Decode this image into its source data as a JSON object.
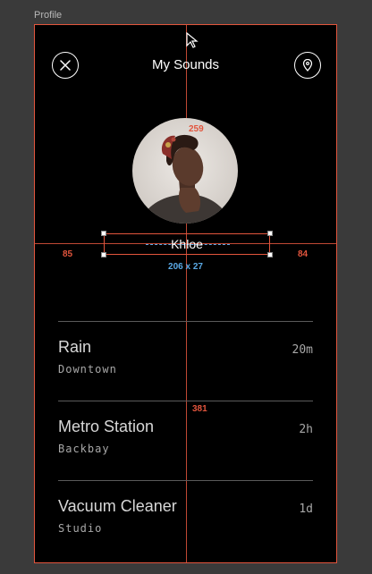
{
  "frame": {
    "label": "Profile"
  },
  "header": {
    "title": "My Sounds",
    "close_icon": "close-icon",
    "pin_icon": "map-pin-icon"
  },
  "profile": {
    "name": "Khloe",
    "avatar_alt": "profile photo"
  },
  "measurements": {
    "avatar_to_top": "259",
    "left_spacing": "85",
    "right_spacing": "84",
    "selection_size": "206 x 27",
    "list_to_bottom": "381"
  },
  "sounds": [
    {
      "title": "Rain",
      "location": "Downtown",
      "duration": "20m"
    },
    {
      "title": "Metro Station",
      "location": "Backbay",
      "duration": "2h"
    },
    {
      "title": "Vacuum Cleaner",
      "location": "Studio",
      "duration": "1d"
    }
  ],
  "colors": {
    "guide": "#e2553d",
    "measure_blue": "#5aa9e6",
    "background": "#000000",
    "canvas": "#3a3a3a"
  }
}
